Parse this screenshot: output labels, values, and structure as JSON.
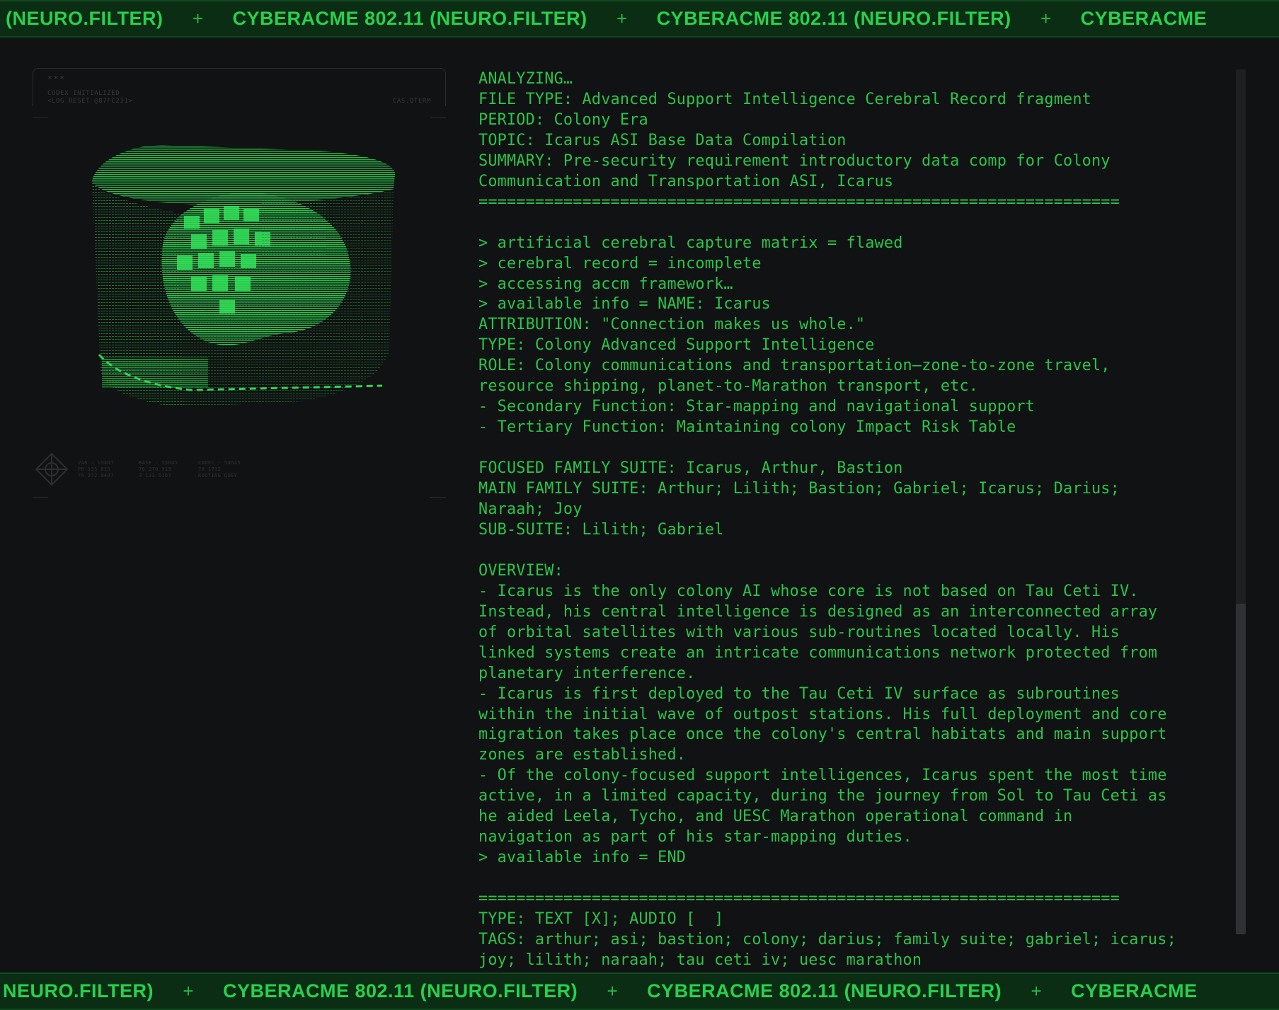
{
  "ticker": {
    "segments_top": [
      "(NEURO.FILTER)",
      "CYBERACME 802.11 (NEURO.FILTER)",
      "CYBERACME 802.11 (NEURO.FILTER)",
      "CYBERACME"
    ],
    "segments_bottom": [
      "NEURO.FILTER)",
      "CYBERACME 802.11 (NEURO.FILTER)",
      "CYBERACME 802.11 (NEURO.FILTER)",
      "CYBERACME"
    ],
    "separator": "+"
  },
  "left_panel": {
    "frame_dots": "***",
    "frame_line1": "CODEX INITIALIZED",
    "frame_line2": "<LOG RESET @87FC231>",
    "frame_right": "CAS.QTERM",
    "stats": [
      [
        "VAR - 194NT",
        "PR 135 815",
        "76 272 8487"
      ],
      [
        "BASE - 53045",
        "76 270 519",
        "3 132 6167"
      ],
      [
        "CODEC - 54645",
        "76 1732",
        "ROUTING QUEY"
      ]
    ]
  },
  "record": {
    "lines": [
      "ANALYZING…",
      "FILE TYPE: Advanced Support Intelligence Cerebral Record fragment",
      "PERIOD: Colony Era",
      "TOPIC: Icarus ASI Base Data Compilation",
      "SUMMARY: Pre-security requirement introductory data comp for Colony",
      "Communication and Transportation ASI, Icarus",
      "====================================================================",
      "",
      "> artificial cerebral capture matrix = flawed",
      "> cerebral record = incomplete",
      "> accessing accm framework…",
      "> available info = NAME: Icarus",
      "ATTRIBUTION: \"Connection makes us whole.\"",
      "TYPE: Colony Advanced Support Intelligence",
      "ROLE: Colony communications and transportation—zone-to-zone travel,",
      "resource shipping, planet-to-Marathon transport, etc.",
      "- Secondary Function: Star-mapping and navigational support",
      "- Tertiary Function: Maintaining colony Impact Risk Table",
      "",
      "FOCUSED FAMILY SUITE: Icarus, Arthur, Bastion",
      "MAIN FAMILY SUITE: Arthur; Lilith; Bastion; Gabriel; Icarus; Darius;",
      "Naraah; Joy",
      "SUB-SUITE: Lilith; Gabriel",
      "",
      "OVERVIEW:",
      "- Icarus is the only colony AI whose core is not based on Tau Ceti IV.",
      "Instead, his central intelligence is designed as an interconnected array",
      "of orbital satellites with various sub-routines located locally. His",
      "linked systems create an intricate communications network protected from",
      "planetary interference.",
      "- Icarus is first deployed to the Tau Ceti IV surface as subroutines",
      "within the initial wave of outpost stations. His full deployment and core",
      "migration takes place once the colony's central habitats and main support",
      "zones are established.",
      "- Of the colony-focused support intelligences, Icarus spent the most time",
      "active, in a limited capacity, during the journey from Sol to Tau Ceti as",
      "he aided Leela, Tycho, and UESC Marathon operational command in",
      "navigation as part of his star-mapping duties.",
      "> available info = END",
      "",
      "====================================================================",
      "TYPE: TEXT [X]; AUDIO [  ]",
      "TAGS: arthur; asi; bastion; colony; darius; family suite; gabriel; icarus;",
      "joy; lilith; naraah; tau ceti iv; uesc marathon"
    ]
  },
  "colors": {
    "background": "#111213",
    "terminal_green": "#29c44a",
    "ticker_bg": "#0b2d14"
  }
}
